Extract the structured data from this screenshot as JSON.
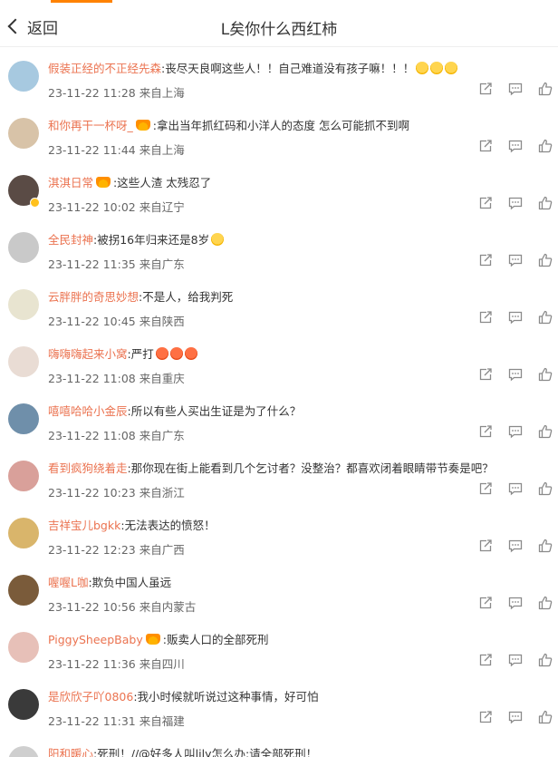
{
  "header": {
    "back_label": "返回",
    "title": "L矣你什么西红柿"
  },
  "comments": [
    {
      "username": "假装正经的不正经先森",
      "text": ":丧尽天良啊这些人！！自己难道没有孩子嘛！！！",
      "meta": "23-11-22 11:28 来自上海",
      "emojis": [
        "cry",
        "cry",
        "cry"
      ],
      "crown": false,
      "verified": false,
      "avatar_color": "#a7c9e0"
    },
    {
      "username": "和你再干一杯呀_",
      "text": ":拿出当年抓红码和小洋人的态度 怎么可能抓不到啊",
      "meta": "23-11-22 11:44 来自上海",
      "emojis": [],
      "crown": true,
      "verified": false,
      "avatar_color": "#d8c3a8"
    },
    {
      "username": "淇淇日常",
      "text": ":这些人渣 太残忍了",
      "meta": "23-11-22 10:02 来自辽宁",
      "emojis": [],
      "crown": true,
      "verified": true,
      "avatar_color": "#5a4b45"
    },
    {
      "username": "全民封神",
      "text": ":被拐16年归来还是8岁",
      "meta": "23-11-22 11:35 来自广东",
      "emojis": [
        "cry"
      ],
      "crown": false,
      "verified": false,
      "avatar_color": "#c9c9c9"
    },
    {
      "username": "云胖胖的奇思妙想",
      "text": ":不是人，给我判死",
      "meta": "23-11-22 10:45 来自陕西",
      "emojis": [],
      "crown": false,
      "verified": false,
      "avatar_color": "#e8e4d0"
    },
    {
      "username": "嗨嗨嗨起来小窝",
      "text": ":严打",
      "meta": "23-11-22 11:08 来自重庆",
      "emojis": [
        "angry",
        "angry",
        "angry"
      ],
      "crown": false,
      "verified": false,
      "avatar_color": "#e9dcd4"
    },
    {
      "username": "嘻嘻哈哈小金辰",
      "text": ":所以有些人买出生证是为了什么？",
      "meta": "23-11-22 11:08 来自广东",
      "emojis": [],
      "crown": false,
      "verified": false,
      "avatar_color": "#6f8faa"
    },
    {
      "username": "看到疯狗绕着走",
      "text": ":那你现在街上能看到几个乞讨者？没整治？都喜欢闭着眼睛带节奏是吧？",
      "meta": "23-11-22 10:23 来自浙江",
      "emojis": [],
      "crown": false,
      "verified": false,
      "avatar_color": "#d9a09a"
    },
    {
      "username": "吉祥宝儿bgkk",
      "text": ":无法表达的愤怒！",
      "meta": "23-11-22 12:23 来自广西",
      "emojis": [],
      "crown": false,
      "verified": false,
      "avatar_color": "#d9b56b"
    },
    {
      "username": "喔喔L咖",
      "text": ":欺负中国人虽远",
      "meta": "23-11-22 10:56 来自内蒙古",
      "emojis": [],
      "crown": false,
      "verified": false,
      "avatar_color": "#7a5b3a"
    },
    {
      "username": "PiggySheepBaby",
      "text": ":贩卖人口的全部死刑",
      "meta": "23-11-22 11:36 来自四川",
      "emojis": [],
      "crown": true,
      "verified": false,
      "avatar_color": "#e7c0b8"
    },
    {
      "username": "是欣欣子吖0806",
      "text": ":我小时候就听说过这种事情，好可怕",
      "meta": "23-11-22 11:31 来自福建",
      "emojis": [],
      "crown": false,
      "verified": false,
      "avatar_color": "#3a3a3a"
    },
    {
      "username": "阳和暖心",
      "text": ":死刑！//@好多人叫lily怎么办:请全部死刑！",
      "meta": "",
      "emojis": [],
      "crown": false,
      "verified": false,
      "avatar_color": "#cfcfcf"
    }
  ],
  "icons": {
    "share": "share-icon",
    "comment": "comment-icon",
    "like": "like-icon",
    "back": "chevron-left-icon"
  },
  "colors": {
    "username": "#eb7350",
    "accent": "#ff8200",
    "icon": "#8a8a8a"
  }
}
